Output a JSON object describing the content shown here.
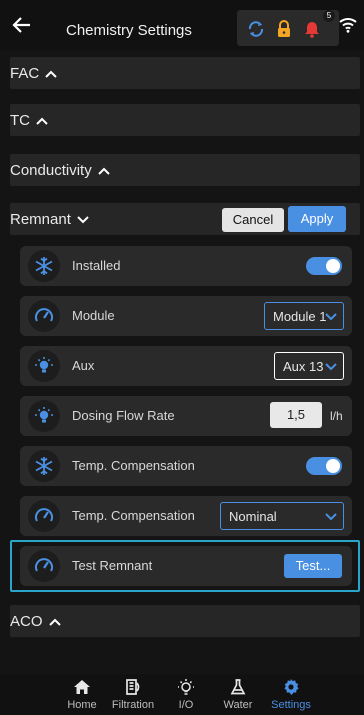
{
  "header": {
    "title": "Chemistry Settings",
    "back_icon": "arrow-left-icon",
    "status_icons": [
      "sync-icon",
      "lock-icon",
      "bell-icon"
    ],
    "notification_count": "5",
    "wifi_icon": "wifi-icon"
  },
  "sections": {
    "fac": "FAC",
    "tc": "TC",
    "conductivity": "Conductivity",
    "remnant": "Remnant",
    "aco": "ACO"
  },
  "remnant_actions": {
    "cancel": "Cancel",
    "apply": "Apply"
  },
  "rows": {
    "installed": {
      "label": "Installed",
      "enabled": true,
      "icon": "snowflake-icon"
    },
    "module": {
      "label": "Module",
      "value": "Module 1",
      "icon": "gauge-icon"
    },
    "aux": {
      "label": "Aux",
      "value": "Aux 13",
      "icon": "bulb-icon"
    },
    "dosing": {
      "label": "Dosing Flow Rate",
      "value": "1,5",
      "unit": "l/h",
      "icon": "bulb-icon"
    },
    "temp_comp_toggle": {
      "label": "Temp. Compensation",
      "enabled": true,
      "icon": "snowflake-icon"
    },
    "temp_comp_select": {
      "label": "Temp. Compensation",
      "value": "Nominal",
      "icon": "gauge-icon"
    },
    "test_remnant": {
      "label": "Test Remnant",
      "button": "Test...",
      "icon": "gauge-icon"
    }
  },
  "nav": {
    "home": "Home",
    "filtration": "Filtration",
    "io": "I/O",
    "water": "Water",
    "settings": "Settings",
    "active": "Settings"
  },
  "colors": {
    "accent": "#4a90e2",
    "highlight": "#2aa4c9",
    "alert": "#e53935",
    "lock": "#f5a623"
  }
}
